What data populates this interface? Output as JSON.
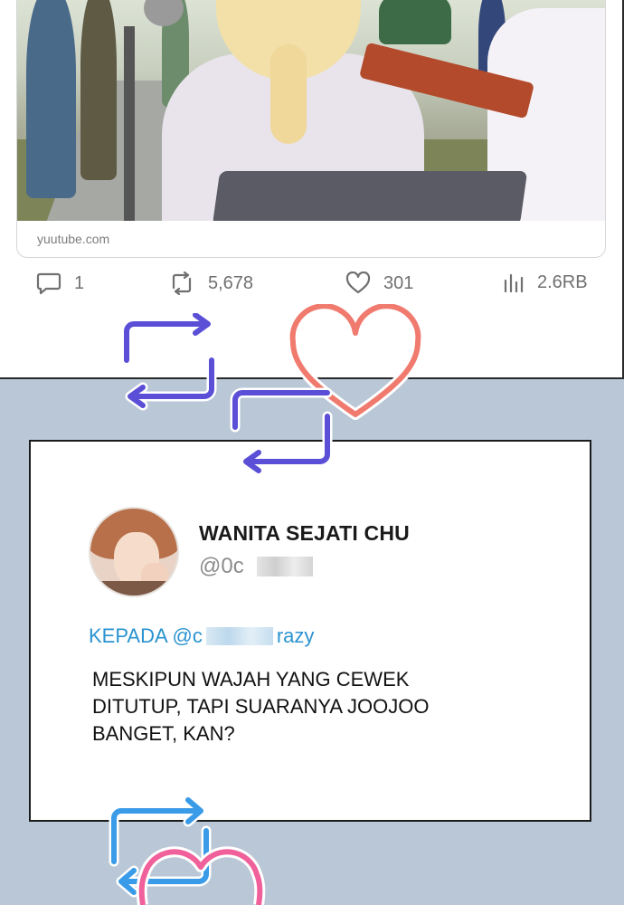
{
  "link_card": {
    "domain": "yuutube.com"
  },
  "actions": {
    "reply_count": "1",
    "retweet_count": "5,678",
    "like_count": "301",
    "views_count": "2.6RB"
  },
  "tweet": {
    "display_name": "WANITA SEJATI CHU",
    "handle_visible": "@0c",
    "reply_prefix": "KEPADA @c",
    "reply_suffix": "razy",
    "body": "MESKIPUN WAJAH YANG CEWEK DITUTUP, TAPI SUARANYA JOOJOO BANGET, KAN?"
  },
  "colors": {
    "retweet_deco": "#5a4fd6",
    "heart_deco": "#f07a6e",
    "retweet_deco_bottom": "#3a9be8",
    "heart_deco_bottom": "#f0609a",
    "reply_link": "#2a93d0",
    "panel_background": "#b9c7d6"
  },
  "icons": {
    "reply": "speech-bubble-icon",
    "retweet": "retweet-icon",
    "like": "heart-icon",
    "views": "bar-chart-icon"
  }
}
